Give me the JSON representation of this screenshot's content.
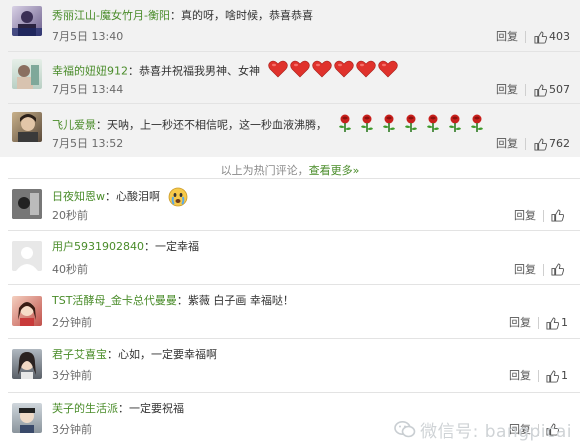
{
  "hot_comments": [
    {
      "user": "秀丽江山-魔女竹月-衡阳",
      "text": "真的呀，啥时候，恭喜恭喜",
      "time": "7月5日 13:40",
      "reply": "回复",
      "likes": "403"
    },
    {
      "user": "幸福的妞妞912",
      "text": "恭喜并祝福我男神、女神",
      "time": "7月5日 13:44",
      "reply": "回复",
      "likes": "507"
    },
    {
      "user": "飞儿爱景",
      "text": "天呐，上一秒还不相信呢，这一秒血液沸腾，",
      "time": "7月5日 13:52",
      "reply": "回复",
      "likes": "762"
    }
  ],
  "divider": {
    "text": "以上为热门评论，",
    "more": "查看更多»"
  },
  "comments": [
    {
      "user": "日夜知恩w",
      "text": "心酸泪啊",
      "time": "20秒前",
      "reply": "回复",
      "likes": ""
    },
    {
      "user": "用户5931902840",
      "text": "一定幸福",
      "time": "40秒前",
      "reply": "回复",
      "likes": ""
    },
    {
      "user": "TST活酵母_金卡总代曼曼",
      "text": "紫薇 白子画 幸福哒！",
      "time": "2分钟前",
      "reply": "回复",
      "likes": "1"
    },
    {
      "user": "君子艾喜宝",
      "text": "心如，一定要幸福啊",
      "time": "3分钟前",
      "reply": "回复",
      "likes": "1"
    },
    {
      "user": "芙子的生活派",
      "text": "一定要祝福",
      "time": "3分钟前",
      "reply": "回复",
      "likes": ""
    }
  ],
  "emojis": {
    "hearts": 6,
    "roses": 7
  },
  "icons": {
    "like": "thumbs-up-icon",
    "heart": "heart-emoji-icon",
    "rose": "rose-emoji-icon",
    "cry": "crying-face-emoji-icon",
    "wechat": "wechat-logo-icon"
  },
  "colors": {
    "username": "#4a8c2a",
    "hot_bg": "#f2f2f2",
    "heart": "#e0322c"
  },
  "watermark": {
    "label": "微信号: bangpicai"
  }
}
